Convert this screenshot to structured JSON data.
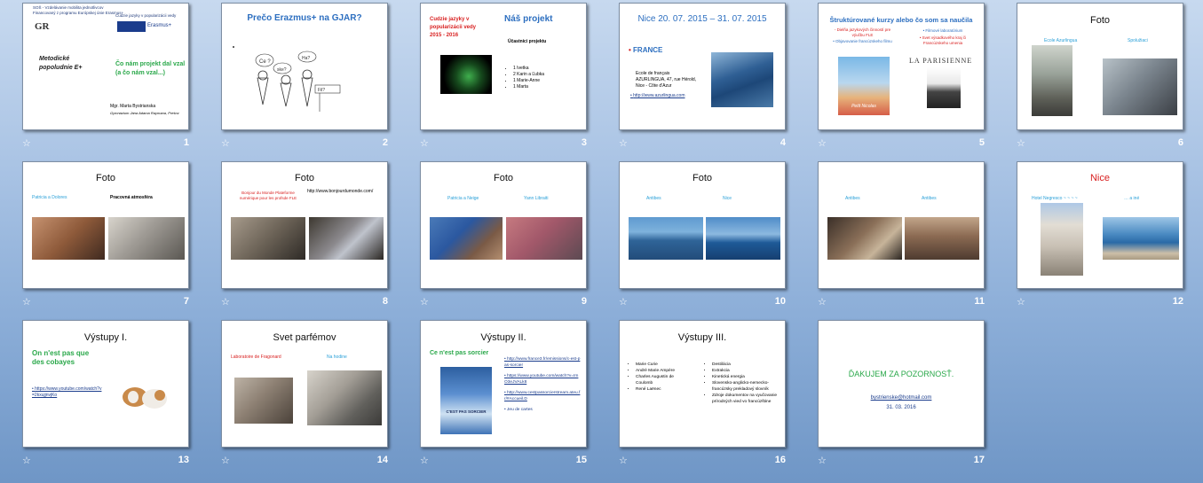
{
  "slides": [
    {
      "num": "1",
      "header1": "SOŠ - Vzdelávanie mobilita jednotlivcov",
      "header2": "Financovaný z programu Európskej únie Erasmus+",
      "header3": "Cudzie jazyky v popularizácii vedy",
      "title": "Metodické popoludnie  E+",
      "subtitle": "Čo nám projekt dal vzal (a čo nám vzal...)",
      "author": "Mgr. Marta Bystrianska",
      "school": "Gymnázium Jána Adama Raymana, Prešov",
      "logo": "Erasmus+"
    },
    {
      "num": "2",
      "title": "Prečo Erazmus+ na GJAR?",
      "bubble1": "Ce ?",
      "bubble2": "ske?",
      "bubble3": "Ha?",
      "sign": "Fil?"
    },
    {
      "num": "3",
      "left_title": "Cudzie jazyky v popularizácii  vedy 2015 - 2016",
      "title": "Náš projekt",
      "participants": "Účastníci projektu",
      "items": [
        "1 Ivetka",
        "2 Karin a Ľubka",
        "1 Marie-Anne",
        "1 Marta"
      ]
    },
    {
      "num": "4",
      "title": "Nice 20. 07. 2015 – 31. 07. 2015",
      "country": "FRANCE",
      "address": "Ecole de français AZURLINGUA, 47, rue Hérold, Nice -  Côte d'Azur",
      "link": "http://www.azurlingua.com"
    },
    {
      "num": "5",
      "title": "Štruktúrované kurzy alebo čo som  sa naučila",
      "left1": "- Dielňa jazykových činností pre výučbu FLE",
      "left2": "• Objavovanie francúzskeho filmu",
      "right1": "• Filmové laboratórium",
      "right2": "• Svet výsadkového kraj či Francúzskeho umenia",
      "poster": "Petit Nicolas",
      "brand": "LA PARISIENNE"
    },
    {
      "num": "6",
      "title": "Foto",
      "cap1": "Ecole Azurlingua",
      "cap2": "Spolužiaci"
    },
    {
      "num": "7",
      "title": "Foto",
      "cap1": "Patricia a Dolores",
      "cap2": "Pracovná atmosféra"
    },
    {
      "num": "8",
      "title": "Foto",
      "cap1": "Bonjour du Monde Plateforme numérique pour les profsde FLE",
      "cap2": "http://www.bonjourdumonde.com/"
    },
    {
      "num": "9",
      "title": "Foto",
      "cap1": "Patricia a Neige",
      "cap2": "Yann Libraiti"
    },
    {
      "num": "10",
      "title": "Foto",
      "cap1": "Antibes",
      "cap2": "Nice"
    },
    {
      "num": "11",
      "title": "",
      "cap1": "Antibes",
      "cap2": "Antibes"
    },
    {
      "num": "12",
      "title": "Nice",
      "cap1": "Hotel  Negresco  ~ ~ ~ ~",
      "cap2": "… a iné"
    },
    {
      "num": "13",
      "title": "Výstupy I.",
      "sub": "On n'est pas que des cobayes",
      "link": "https://www.youtube.com/watch?v=2kxujjnvjKo"
    },
    {
      "num": "14",
      "title": "Svet parfémov",
      "cap1": "Laboratoire  de Fragonard",
      "cap2": "Na hodine"
    },
    {
      "num": "15",
      "title": "Výstupy II.",
      "sub": "Ce n'est pas sorcier",
      "links": [
        "http://www.france3.fr/emissions/c-est-pas-sorcier",
        "https://www.youtube.com/watch?v=ImO3eJVALk8",
        "http://www.cestpassorcierstream.ateu.fr/#Accueil.D"
      ],
      "last": "Jeu de cartes",
      "poster": "C'EST PAS SORCIER"
    },
    {
      "num": "16",
      "title": "Výstupy III.",
      "left": [
        "Marie  Curie",
        "André Marie  Ampère",
        "Charles  Augustin  de Coulomb",
        "René Laënec"
      ],
      "right": [
        "Destilácia",
        "Extrakcia",
        "Kinetická energia",
        "Slovensko-anglicko-nemecko-francúzsky prekladový slovník",
        "Zdroje dokumentov  na vyučovanie prírodných  vied vo francúzštine"
      ]
    },
    {
      "num": "17",
      "title": "ĎAKUJEM ZA POZORNOSŤ.",
      "email": "bystrienske@hotmail.com",
      "date": "31. 03. 2016"
    }
  ],
  "star_icon": "☆"
}
